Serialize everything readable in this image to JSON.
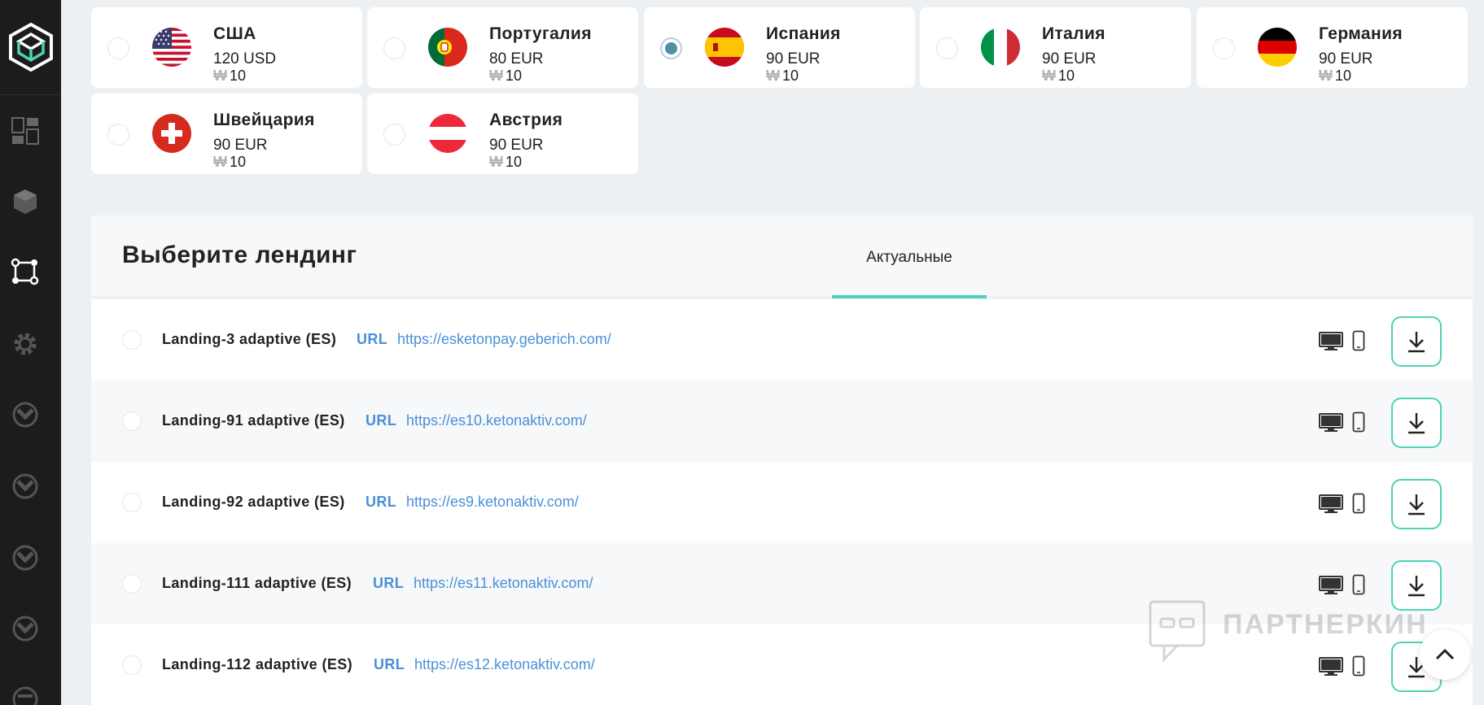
{
  "countries": [
    {
      "name": "США",
      "price": "120 USD",
      "points": "10",
      "flag": "usa",
      "selected": false
    },
    {
      "name": "Португалия",
      "price": "80 EUR",
      "points": "10",
      "flag": "portugal",
      "selected": false
    },
    {
      "name": "Испания",
      "price": "90 EUR",
      "points": "10",
      "flag": "spain",
      "selected": true
    },
    {
      "name": "Италия",
      "price": "90 EUR",
      "points": "10",
      "flag": "italy",
      "selected": false
    },
    {
      "name": "Германия",
      "price": "90 EUR",
      "points": "10",
      "flag": "germany",
      "selected": false
    },
    {
      "name": "Швейцария",
      "price": "90 EUR",
      "points": "10",
      "flag": "switzerland",
      "selected": false
    },
    {
      "name": "Австрия",
      "price": "90 EUR",
      "points": "10",
      "flag": "austria",
      "selected": false
    }
  ],
  "points_symbol": "₩",
  "landing": {
    "title": "Выберите лендинг",
    "tab_active": "Актуальные",
    "url_label": "URL",
    "rows": [
      {
        "name": "Landing-3 adaptive (ES)",
        "url": "https://esketonpay.geberich.com/"
      },
      {
        "name": "Landing-91 adaptive (ES)",
        "url": "https://es10.ketonaktiv.com/"
      },
      {
        "name": "Landing-92 adaptive (ES)",
        "url": "https://es9.ketonaktiv.com/"
      },
      {
        "name": "Landing-111 adaptive (ES)",
        "url": "https://es11.ketonaktiv.com/"
      },
      {
        "name": "Landing-112 adaptive (ES)",
        "url": "https://es12.ketonaktiv.com/"
      }
    ]
  },
  "watermark": "ПАРТНЕРКИН",
  "sidebar": {
    "icons": [
      "logo-icon",
      "dashboard-icon",
      "offers-icon",
      "flows-icon",
      "settings-icon",
      "stats-icon",
      "stats-icon",
      "stats-icon",
      "stats-icon",
      "more-icon"
    ]
  },
  "colors": {
    "accent": "#4fd1b8",
    "link": "#4a90d9",
    "sidebar": "#1c1c1c",
    "radio_selected": "#4f8ea6"
  }
}
